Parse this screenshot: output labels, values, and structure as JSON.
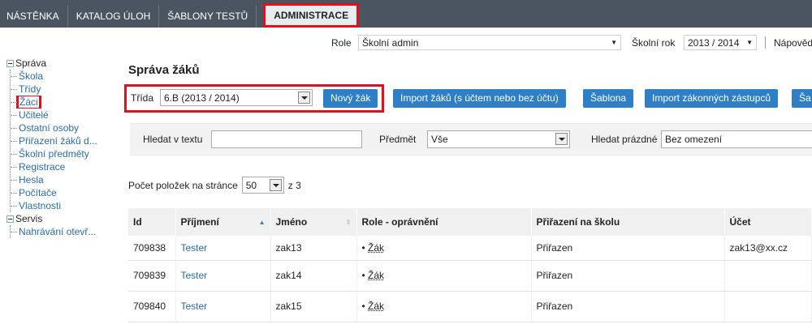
{
  "topnav": {
    "tabs": [
      "NÁSTĚNKA",
      "KATALOG ÚLOH",
      "ŠABLONY TESTŮ",
      "ADMINISTRACE"
    ]
  },
  "rolebar": {
    "role_label": "Role",
    "role_value": "Školní admin",
    "year_label": "Školní rok",
    "year_value": "2013 / 2014",
    "help": "Nápověd"
  },
  "sidebar": {
    "group1": "Správa",
    "items": [
      "Škola",
      "Třídy",
      "Žáci",
      "Učitelé",
      "Ostatní osoby",
      "Přiřazení žáků d...",
      "Školní předměty",
      "Registrace",
      "Hesla",
      "Počítače",
      "Vlastnosti"
    ],
    "group2": "Servis",
    "items2": [
      "Nahrávání otevř..."
    ]
  },
  "main": {
    "title": "Správa žáků",
    "trida_label": "Třída",
    "trida_value": "6.B (2013 / 2014)",
    "buttons": {
      "new_student": "Nový žák",
      "import_students": "Import žáků (s účtem nebo bez účtu)",
      "template": "Šablona",
      "import_guardians": "Import zákonných zástupců",
      "more": "Ša"
    },
    "filters": {
      "search_label": "Hledat v textu",
      "search_value": "",
      "subject_label": "Předmět",
      "subject_value": "Vše",
      "empty_label": "Hledat prázdné",
      "empty_value": "Bez omezení"
    },
    "pager": {
      "label": "Počet položek na stránce",
      "per_page": "50",
      "of": "z 3"
    },
    "table": {
      "headers": [
        "Id",
        "Příjmení",
        "Jméno",
        "Role - oprávnění",
        "Přiřazení na školu",
        "Účet"
      ],
      "rows": [
        {
          "id": "709838",
          "surname": "Tester",
          "name": "zak13",
          "role": "Žák",
          "assign": "Přiřazen",
          "account": "zak13@xx.cz"
        },
        {
          "id": "709839",
          "surname": "Tester",
          "name": "zak14",
          "role": "Žák",
          "assign": "Přiřazen",
          "account": ""
        },
        {
          "id": "709840",
          "surname": "Tester",
          "name": "zak15",
          "role": "Žák",
          "assign": "Přiřazen",
          "account": ""
        }
      ]
    }
  },
  "colors": {
    "nav_bg": "#4a5560",
    "button_blue": "#2f7fc8",
    "highlight_red": "#e0101d",
    "link_blue": "#2a6bb0"
  }
}
